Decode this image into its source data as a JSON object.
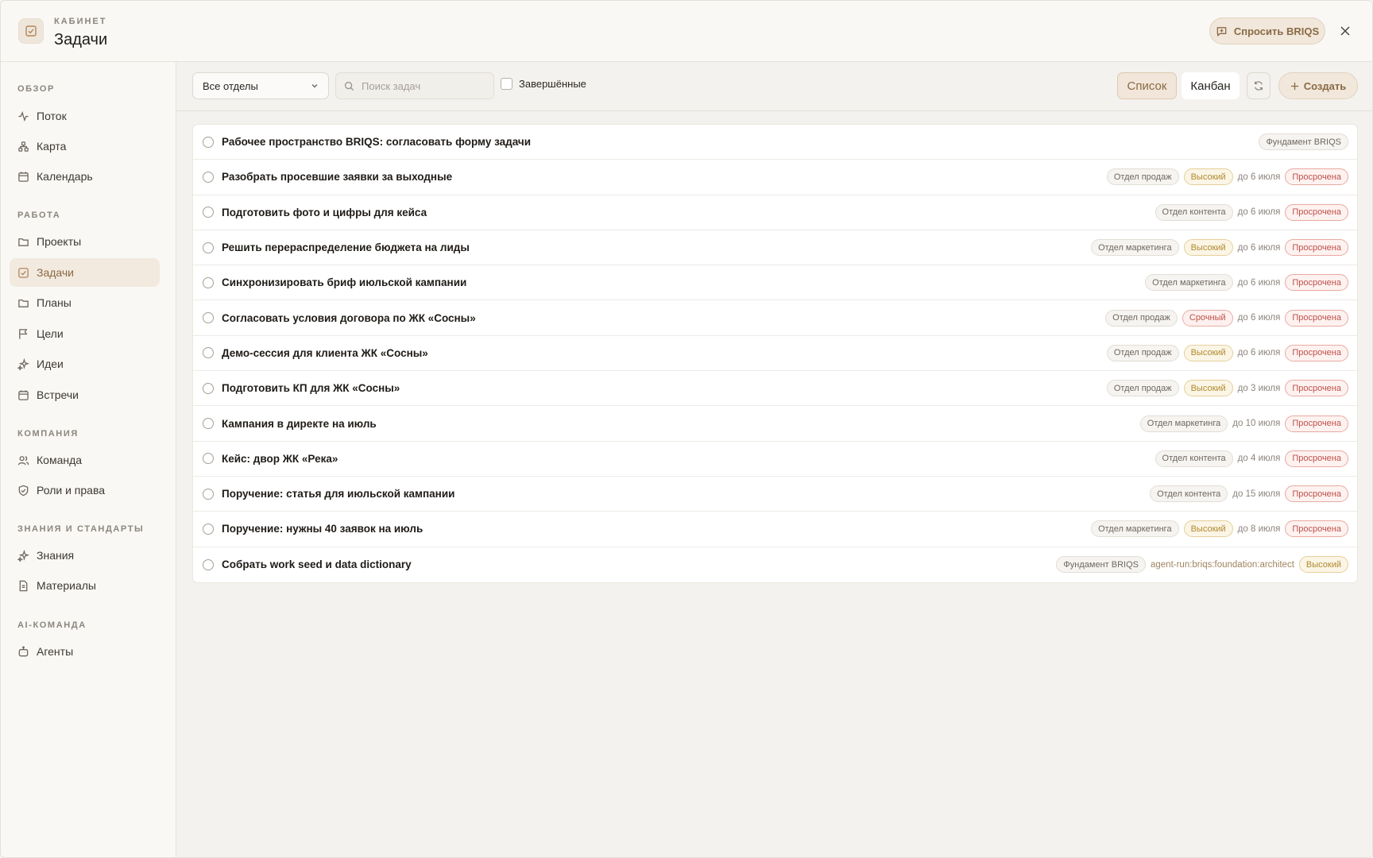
{
  "header": {
    "kicker": "КАБИНЕТ",
    "title": "Задачи",
    "ask_label": "Спросить BRIQS"
  },
  "sidebar": {
    "sections": [
      {
        "label": "ОБЗОР"
      },
      {
        "label": "РАБОТА"
      },
      {
        "label": "КОМПАНИЯ"
      },
      {
        "label": "ЗНАНИЯ И СТАНДАРТЫ"
      },
      {
        "label": "AI-КОМАНДА"
      }
    ],
    "items": [
      {
        "label": "Поток",
        "icon": "activity-icon"
      },
      {
        "label": "Карта",
        "icon": "map-icon"
      },
      {
        "label": "Календарь",
        "icon": "calendar-icon"
      },
      {
        "label": "Проекты",
        "icon": "folder-icon"
      },
      {
        "label": "Задачи",
        "icon": "task-check-icon",
        "active": true
      },
      {
        "label": "Планы",
        "icon": "folder-icon"
      },
      {
        "label": "Цели",
        "icon": "flag-icon"
      },
      {
        "label": "Идеи",
        "icon": "sparkle-icon"
      },
      {
        "label": "Встречи",
        "icon": "calendar-icon"
      },
      {
        "label": "Команда",
        "icon": "users-icon"
      },
      {
        "label": "Роли и права",
        "icon": "shield-icon"
      },
      {
        "label": "Знания",
        "icon": "sparkle-icon"
      },
      {
        "label": "Материалы",
        "icon": "document-icon"
      },
      {
        "label": "Агенты",
        "icon": "bot-icon"
      }
    ]
  },
  "toolbar": {
    "department_select": "Все отделы",
    "search_placeholder": "Поиск задач",
    "completed_label": "Завершённые",
    "list_label": "Список",
    "kanban_label": "Канбан",
    "create_label": "Создать"
  },
  "tasks": [
    {
      "title": "Рабочее пространство BRIQS: согласовать форму задачи",
      "tags": [
        {
          "type": "dept",
          "text": "Фундамент BRIQS"
        }
      ]
    },
    {
      "title": "Разобрать просевшие заявки за выходные",
      "tags": [
        {
          "type": "dept",
          "text": "Отдел продаж"
        },
        {
          "type": "high",
          "text": "Высокий"
        },
        {
          "type": "due",
          "text": "до 6 июля"
        },
        {
          "type": "overdue",
          "text": "Просрочена"
        }
      ]
    },
    {
      "title": "Подготовить фото и цифры для кейса",
      "tags": [
        {
          "type": "dept",
          "text": "Отдел контента"
        },
        {
          "type": "due",
          "text": "до 6 июля"
        },
        {
          "type": "overdue",
          "text": "Просрочена"
        }
      ]
    },
    {
      "title": "Решить перераспределение бюджета на лиды",
      "tags": [
        {
          "type": "dept",
          "text": "Отдел маркетинга"
        },
        {
          "type": "high",
          "text": "Высокий"
        },
        {
          "type": "due",
          "text": "до 6 июля"
        },
        {
          "type": "overdue",
          "text": "Просрочена"
        }
      ]
    },
    {
      "title": "Синхронизировать бриф июльской кампании",
      "tags": [
        {
          "type": "dept",
          "text": "Отдел маркетинга"
        },
        {
          "type": "due",
          "text": "до 6 июля"
        },
        {
          "type": "overdue",
          "text": "Просрочена"
        }
      ]
    },
    {
      "title": "Согласовать условия договора по ЖК «Сосны»",
      "tags": [
        {
          "type": "dept",
          "text": "Отдел продаж"
        },
        {
          "type": "urgent",
          "text": "Срочный"
        },
        {
          "type": "due",
          "text": "до 6 июля"
        },
        {
          "type": "overdue",
          "text": "Просрочена"
        }
      ]
    },
    {
      "title": "Демо-сессия для клиента ЖК «Сосны»",
      "tags": [
        {
          "type": "dept",
          "text": "Отдел продаж"
        },
        {
          "type": "high",
          "text": "Высокий"
        },
        {
          "type": "due",
          "text": "до 6 июля"
        },
        {
          "type": "overdue",
          "text": "Просрочена"
        }
      ]
    },
    {
      "title": "Подготовить КП для ЖК «Сосны»",
      "tags": [
        {
          "type": "dept",
          "text": "Отдел продаж"
        },
        {
          "type": "high",
          "text": "Высокий"
        },
        {
          "type": "due",
          "text": "до 3 июля"
        },
        {
          "type": "overdue",
          "text": "Просрочена"
        }
      ]
    },
    {
      "title": "Кампания в директе на июль",
      "tags": [
        {
          "type": "dept",
          "text": "Отдел маркетинга"
        },
        {
          "type": "due",
          "text": "до 10 июля"
        },
        {
          "type": "overdue",
          "text": "Просрочена"
        }
      ]
    },
    {
      "title": "Кейс: двор ЖК «Река»",
      "tags": [
        {
          "type": "dept",
          "text": "Отдел контента"
        },
        {
          "type": "due",
          "text": "до 4 июля"
        },
        {
          "type": "overdue",
          "text": "Просрочена"
        }
      ]
    },
    {
      "title": "Поручение: статья для июльской кампании",
      "tags": [
        {
          "type": "dept",
          "text": "Отдел контента"
        },
        {
          "type": "due",
          "text": "до 15 июля"
        },
        {
          "type": "overdue",
          "text": "Просрочена"
        }
      ]
    },
    {
      "title": "Поручение: нужны 40 заявок на июль",
      "tags": [
        {
          "type": "dept",
          "text": "Отдел маркетинга"
        },
        {
          "type": "high",
          "text": "Высокий"
        },
        {
          "type": "due",
          "text": "до 8 июля"
        },
        {
          "type": "overdue",
          "text": "Просрочена"
        }
      ]
    },
    {
      "title": "Собрать work seed и data dictionary",
      "tags": [
        {
          "type": "dept",
          "text": "Фундамент BRIQS"
        },
        {
          "type": "assignee",
          "text": "agent-run:briqs:foundation:architect"
        },
        {
          "type": "high",
          "text": "Высокий"
        }
      ]
    }
  ],
  "colors": {
    "accent": "#8a6a45",
    "accent_bg": "#f1e7db",
    "overdue": "#c0504a",
    "high": "#b08a2e"
  }
}
